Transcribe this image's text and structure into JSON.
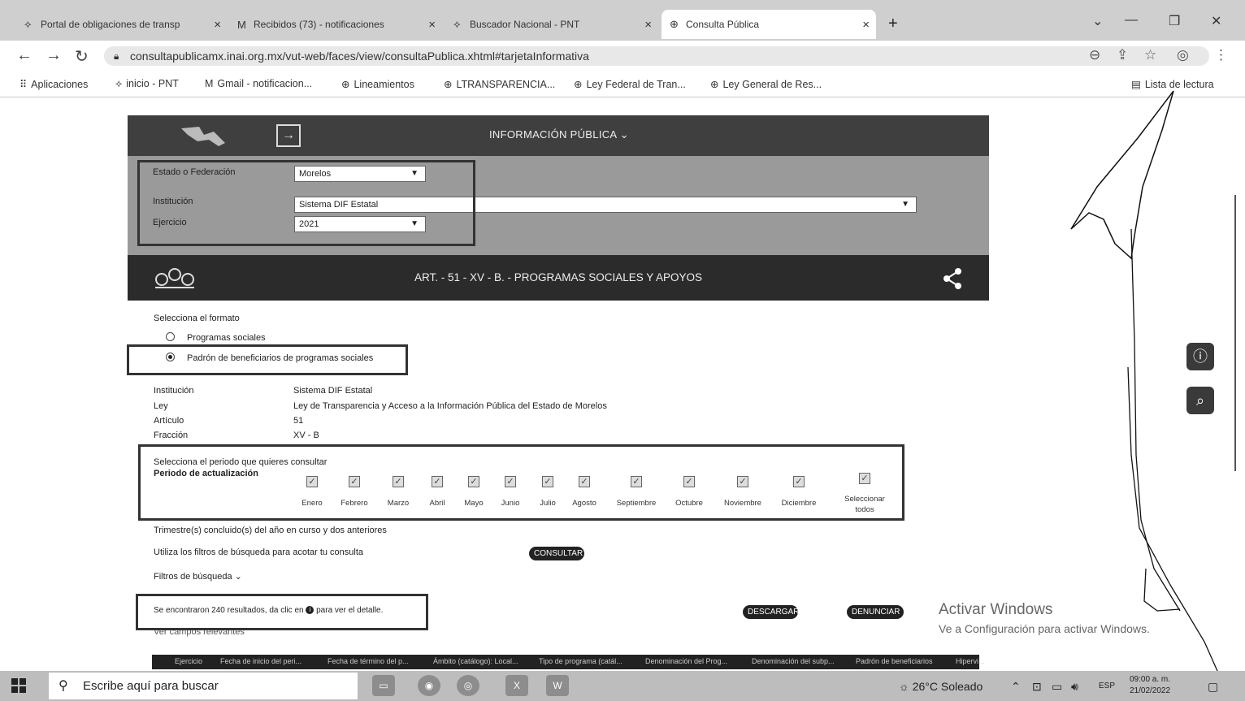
{
  "browser": {
    "tabs": [
      {
        "title": "Portal de obligaciones de transp",
        "icon": "pnt-icon"
      },
      {
        "title": "Recibidos (73) - notificaciones",
        "icon": "gmail-icon"
      },
      {
        "title": "Buscador Nacional - PNT",
        "icon": "pnt-icon"
      },
      {
        "title": "Consulta Pública",
        "icon": "globe-icon",
        "active": true
      }
    ],
    "url": "consultapublicamx.inai.org.mx/vut-web/faces/view/consultaPublica.xhtml#tarjetaInformativa",
    "bookmarks": [
      {
        "label": "Aplicaciones",
        "icon": "apps-grid-icon"
      },
      {
        "label": "inicio - PNT",
        "icon": "pnt-icon"
      },
      {
        "label": "Gmail - notificacion...",
        "icon": "gmail-icon"
      },
      {
        "label": "Lineamientos",
        "icon": "globe-icon"
      },
      {
        "label": "LTRANSPARENCIA...",
        "icon": "globe-icon"
      },
      {
        "label": "Ley Federal de Tran...",
        "icon": "globe-icon"
      },
      {
        "label": "Ley General de Res...",
        "icon": "globe-icon"
      }
    ],
    "reading_list": "Lista de lectura"
  },
  "header": {
    "menu": "INFORMACIÓN PÚBLICA"
  },
  "filters": {
    "estado_label": "Estado o Federación",
    "estado_value": "Morelos",
    "institucion_label": "Institución",
    "institucion_value": "Sistema DIF Estatal",
    "ejercicio_label": "Ejercicio",
    "ejercicio_value": "2021"
  },
  "section": {
    "title": "ART. - 51 - XV - B. - PROGRAMAS SOCIALES Y APOYOS"
  },
  "format": {
    "label": "Selecciona el formato",
    "options": [
      "Programas sociales",
      "Padrón de beneficiarios de programas sociales"
    ],
    "selected": 1
  },
  "info": {
    "rows": [
      {
        "k": "Institución",
        "v": "Sistema DIF Estatal"
      },
      {
        "k": "Ley",
        "v": "Ley de Transparencia y Acceso a la Información Pública del Estado de Morelos"
      },
      {
        "k": "Artículo",
        "v": "51"
      },
      {
        "k": "Fracción",
        "v": "XV - B"
      }
    ]
  },
  "period": {
    "label": "Selecciona el periodo que quieres consultar",
    "sub_label": "Periodo de actualización",
    "months": [
      "Enero",
      "Febrero",
      "Marzo",
      "Abril",
      "Mayo",
      "Junio",
      "Julio",
      "Agosto",
      "Septiembre",
      "Octubre",
      "Noviembre",
      "Diciembre"
    ],
    "select_all_1": "Seleccionar",
    "select_all_2": "todos",
    "note": "Trimestre(s) concluido(s) del año en curso y dos anteriores"
  },
  "search": {
    "hint": "Utiliza los filtros de búsqueda para acotar tu consulta",
    "consultar": "CONSULTAR",
    "filters_toggle": "Filtros de búsqueda ⌄"
  },
  "results": {
    "text_pre": "Se encontraron 240 resultados, da clic en",
    "text_post": "para ver el detalle.",
    "fields_link": "Ver campos relevantes",
    "descargar": "DESCARGAR",
    "denunciar": "DENUNCIAR"
  },
  "table_headers": [
    "Ejercicio",
    "Fecha de inicio del peri...",
    "Fecha de término del p...",
    "Ámbito (catálogo): Local...",
    "Tipo de programa (catál...",
    "Denominación del Prog...",
    "Denominación del subp...",
    "Padrón de beneficiarios",
    "Hipervi..."
  ],
  "windows_activation": {
    "line1": "Activar Windows",
    "line2": "Ve a Configuración para activar Windows."
  },
  "taskbar": {
    "search_placeholder": "Escribe aquí para buscar",
    "weather": "26°C  Soleado",
    "lang": "ESP",
    "time": "09:00 a. m.",
    "date": "21/02/2022"
  },
  "colors": {
    "header_bg": "#3f3f3f",
    "filters_bg": "#9a9a9a",
    "section_bg": "#2b2b2b",
    "highlight_border": "#333333"
  }
}
